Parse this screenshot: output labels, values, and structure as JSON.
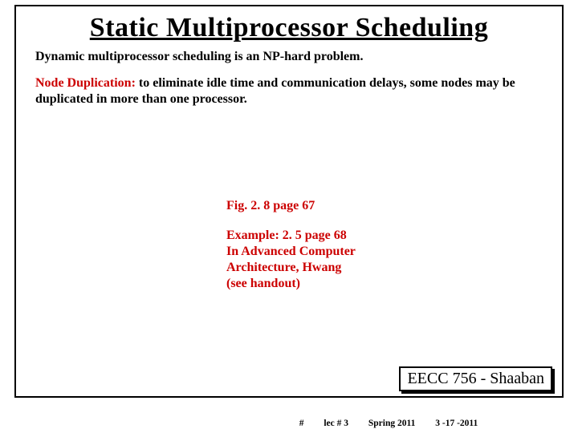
{
  "slide": {
    "title": "Static Multiprocessor Scheduling",
    "line1": "Dynamic multiprocessor scheduling is an NP-hard problem.",
    "line2_lead": "Node Duplication:",
    "line2_rest": "  to eliminate idle time and communication delays, some nodes may be duplicated in more than one processor.",
    "fig_ref": "Fig. 2. 8 page 67",
    "example_l1": "Example: 2. 5 page 68",
    "example_l2": "In Advanced  Computer",
    "example_l3": "Architecture, Hwang",
    "example_l4": "(see handout)"
  },
  "footer": {
    "badge": "EECC 756 - Shaaban",
    "slide_no": "#",
    "lec": "lec # 3",
    "term": "Spring 2011",
    "date": "3 -17 -2011"
  }
}
